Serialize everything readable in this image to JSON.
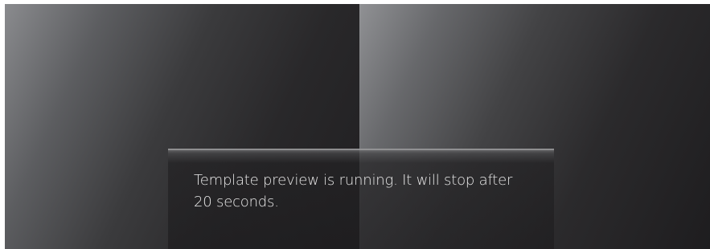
{
  "preview": {
    "message": "Template preview is running. It will stop after 20 seconds."
  }
}
